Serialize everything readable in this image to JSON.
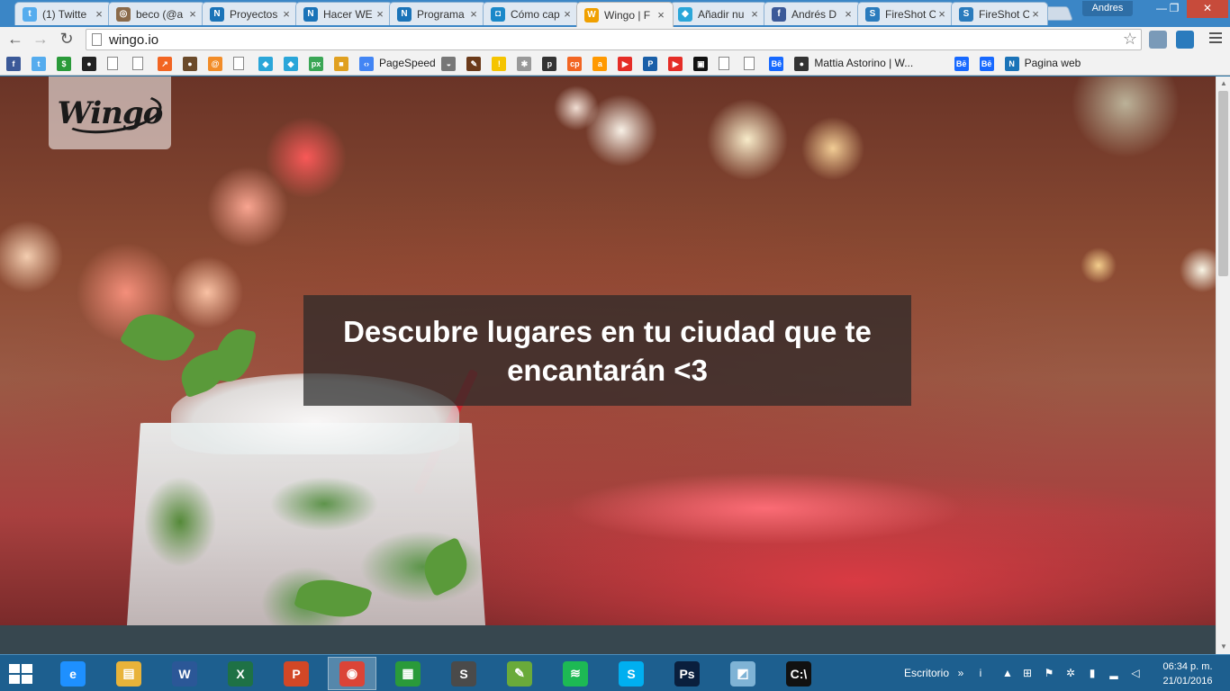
{
  "browser": {
    "tabs": [
      {
        "title": "(1) Twitte",
        "icon": "twitter-icon",
        "color": "#55acee",
        "glyph": "t",
        "active": false
      },
      {
        "title": "beco (@a",
        "icon": "instagram-icon",
        "color": "#8a6a4a",
        "glyph": "◎",
        "active": false
      },
      {
        "title": "Proyectos",
        "icon": "n-icon",
        "color": "#1a73b8",
        "glyph": "N",
        "active": false
      },
      {
        "title": "Hacer WE",
        "icon": "n-icon",
        "color": "#1a73b8",
        "glyph": "N",
        "active": false
      },
      {
        "title": "Programa",
        "icon": "n-icon",
        "color": "#1a73b8",
        "glyph": "N",
        "active": false
      },
      {
        "title": "Cómo cap",
        "icon": "chat-icon",
        "color": "#1a88c9",
        "glyph": "◘",
        "active": false
      },
      {
        "title": "Wingo | F",
        "icon": "wingo-icon",
        "color": "#f0a000",
        "glyph": "W",
        "active": true
      },
      {
        "title": "Añadir nu",
        "icon": "diamond-icon",
        "color": "#2aa6d9",
        "glyph": "◆",
        "active": false
      },
      {
        "title": "Andrés D",
        "icon": "facebook-icon",
        "color": "#3b5998",
        "glyph": "f",
        "active": false
      },
      {
        "title": "FireShot C",
        "icon": "fireshot-icon",
        "color": "#2a7bbd",
        "glyph": "S",
        "active": false
      },
      {
        "title": "FireShot C",
        "icon": "fireshot-icon",
        "color": "#2a7bbd",
        "glyph": "S",
        "active": false
      }
    ],
    "profile_name": "Andres",
    "window_controls": {
      "minimize": "—",
      "maximize": "❐",
      "close": "✕"
    },
    "nav": {
      "back": "←",
      "forward": "→",
      "reload": "↻"
    },
    "url": "wingo.io",
    "star_glyph": "☆",
    "bookmarks": [
      {
        "icon": "facebook-icon",
        "color": "#3b5998",
        "glyph": "f",
        "label": ""
      },
      {
        "icon": "twitter-icon",
        "color": "#55acee",
        "glyph": "t",
        "label": ""
      },
      {
        "icon": "money-icon",
        "color": "#2a9a3a",
        "glyph": "$",
        "label": ""
      },
      {
        "icon": "github-icon",
        "color": "#222222",
        "glyph": "●",
        "label": ""
      },
      {
        "icon": "document-icon",
        "color": "doc",
        "glyph": "",
        "label": ""
      },
      {
        "icon": "document-icon",
        "color": "doc",
        "glyph": "",
        "label": ""
      },
      {
        "icon": "chart-icon",
        "color": "#f26522",
        "glyph": "↗",
        "label": ""
      },
      {
        "icon": "avatar-icon",
        "color": "#6b4a2a",
        "glyph": "●",
        "label": ""
      },
      {
        "icon": "at-icon",
        "color": "#f28c28",
        "glyph": "@",
        "label": ""
      },
      {
        "icon": "document-icon",
        "color": "doc",
        "glyph": "",
        "label": ""
      },
      {
        "icon": "diamond-icon",
        "color": "#2aa6d9",
        "glyph": "◆",
        "label": ""
      },
      {
        "icon": "diamond-icon",
        "color": "#2aa6d9",
        "glyph": "◆",
        "label": ""
      },
      {
        "icon": "px-icon",
        "color": "#3aa655",
        "glyph": "px",
        "label": ""
      },
      {
        "icon": "windows-icon",
        "color": "#e0a020",
        "glyph": "■",
        "label": ""
      },
      {
        "icon": "pagespeed-icon",
        "color": "#4285f4",
        "glyph": "‹›",
        "label": "PageSpeed"
      },
      {
        "icon": "bowl-icon",
        "color": "#777777",
        "glyph": "◒",
        "label": ""
      },
      {
        "icon": "brush-icon",
        "color": "#6b3a1a",
        "glyph": "✎",
        "label": ""
      },
      {
        "icon": "thermometer-icon",
        "color": "#f5c400",
        "glyph": "!",
        "label": ""
      },
      {
        "icon": "bee-icon",
        "color": "#999999",
        "glyph": "✱",
        "label": ""
      },
      {
        "icon": "p-icon",
        "color": "#333333",
        "glyph": "p",
        "label": ""
      },
      {
        "icon": "cp-icon",
        "color": "#f26522",
        "glyph": "cp",
        "label": ""
      },
      {
        "icon": "amazon-icon",
        "color": "#ff9900",
        "glyph": "a",
        "label": ""
      },
      {
        "icon": "youtube-icon",
        "color": "#e52d27",
        "glyph": "▶",
        "label": ""
      },
      {
        "icon": "paypal-icon",
        "color": "#1a5fa8",
        "glyph": "P",
        "label": ""
      },
      {
        "icon": "youtube-icon",
        "color": "#e52d27",
        "glyph": "▶",
        "label": ""
      },
      {
        "icon": "invader-icon",
        "color": "#111111",
        "glyph": "▣",
        "label": ""
      },
      {
        "icon": "document-icon",
        "color": "doc",
        "glyph": "",
        "label": ""
      },
      {
        "icon": "document-icon",
        "color": "doc",
        "glyph": "",
        "label": ""
      },
      {
        "icon": "behance-icon",
        "color": "#1769ff",
        "glyph": "Bē",
        "label": ""
      },
      {
        "icon": "medium-icon",
        "color": "#333333",
        "glyph": "●",
        "label": "Mattia Astorino | W..."
      },
      {
        "icon": "behance-icon",
        "color": "#1769ff",
        "glyph": "Bē",
        "label": ""
      },
      {
        "icon": "behance-icon",
        "color": "#1769ff",
        "glyph": "Bē",
        "label": ""
      },
      {
        "icon": "n-icon",
        "color": "#1a73b8",
        "glyph": "N",
        "label": "Pagina web"
      }
    ]
  },
  "site": {
    "logo_text": "Wingo",
    "hero_text": "Descubre lugares en tu ciudad que te encantarán <3"
  },
  "taskbar": {
    "apps": [
      {
        "icon": "ie-icon",
        "color": "#1e90ff",
        "glyph": "e",
        "active": false
      },
      {
        "icon": "explorer-icon",
        "color": "#e8b33a",
        "glyph": "▤",
        "active": false
      },
      {
        "icon": "word-icon",
        "color": "#2b5797",
        "glyph": "W",
        "active": false
      },
      {
        "icon": "excel-icon",
        "color": "#1e7145",
        "glyph": "X",
        "active": false
      },
      {
        "icon": "powerpoint-icon",
        "color": "#d24726",
        "glyph": "P",
        "active": false
      },
      {
        "icon": "chrome-icon",
        "color": "#db4437",
        "glyph": "◉",
        "active": true
      },
      {
        "icon": "store-icon",
        "color": "#2a9a3a",
        "glyph": "▦",
        "active": false
      },
      {
        "icon": "sublime-icon",
        "color": "#4a4a4a",
        "glyph": "S",
        "active": false
      },
      {
        "icon": "evernote-icon",
        "color": "#6aaa3a",
        "glyph": "✎",
        "active": false
      },
      {
        "icon": "spotify-icon",
        "color": "#1db954",
        "glyph": "≋",
        "active": false
      },
      {
        "icon": "skype-icon",
        "color": "#00aff0",
        "glyph": "S",
        "active": false
      },
      {
        "icon": "photoshop-icon",
        "color": "#0a1f3d",
        "glyph": "Ps",
        "active": false
      },
      {
        "icon": "notepad-icon",
        "color": "#7fb3d5",
        "glyph": "◩",
        "active": false
      },
      {
        "icon": "cmd-icon",
        "color": "#111111",
        "glyph": "C:\\",
        "active": false
      }
    ],
    "desktop_label": "Escritorio",
    "time": "06:34 p. m.",
    "date": "21/01/2016"
  }
}
